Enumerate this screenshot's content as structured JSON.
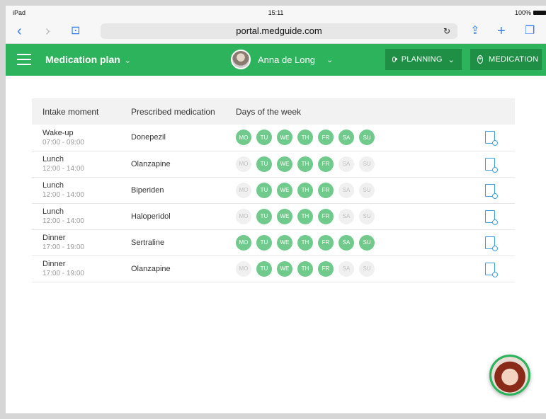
{
  "status": {
    "device": "iPad",
    "time": "15:11",
    "battery": "100%"
  },
  "browser": {
    "url": "portal.medguide.com"
  },
  "appbar": {
    "title": "Medication plan",
    "user": "Anna de Long",
    "planning": "PLANNING",
    "medication": "MEDICATION"
  },
  "table": {
    "headers": [
      "Intake moment",
      "Prescribed medication",
      "Days of the week"
    ],
    "rows": [
      {
        "moment": "Wake-up",
        "time": "07:00 - 09:00",
        "medication": "Donepezil",
        "days": [
          1,
          1,
          1,
          1,
          1,
          1,
          1
        ]
      },
      {
        "moment": "Lunch",
        "time": "12:00 - 14:00",
        "medication": "Olanzapine",
        "days": [
          0,
          1,
          1,
          1,
          1,
          0,
          0
        ]
      },
      {
        "moment": "Lunch",
        "time": "12:00 - 14:00",
        "medication": "Biperiden",
        "days": [
          0,
          1,
          1,
          1,
          1,
          0,
          0
        ]
      },
      {
        "moment": "Lunch",
        "time": "12:00 - 14:00",
        "medication": "Haloperidol",
        "days": [
          0,
          1,
          1,
          1,
          1,
          0,
          0
        ]
      },
      {
        "moment": "Dinner",
        "time": "17:00 - 19:00",
        "medication": "Sertraline",
        "days": [
          1,
          1,
          1,
          1,
          1,
          1,
          1
        ]
      },
      {
        "moment": "Dinner",
        "time": "17:00 - 19:00",
        "medication": "Olanzapine",
        "days": [
          0,
          1,
          1,
          1,
          1,
          0,
          0
        ]
      }
    ],
    "day_labels": [
      "MO",
      "TU",
      "WE",
      "TH",
      "FR",
      "SA",
      "SU"
    ]
  },
  "colors": {
    "brand": "#2db35c",
    "day_on": "#6fca8c",
    "day_off": "#f0f0f0",
    "link": "#3a9de0"
  }
}
